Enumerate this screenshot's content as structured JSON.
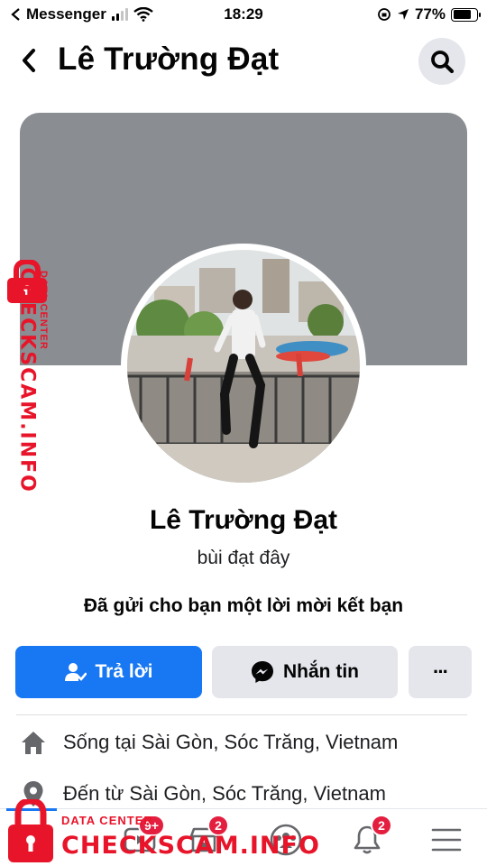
{
  "status_bar": {
    "carrier": "Messenger",
    "time": "18:29",
    "battery": "77%",
    "battery_level": 0.77
  },
  "header": {
    "title": "Lê Trường Đạt",
    "back_icon": "chevron-left-icon",
    "search_icon": "search-icon"
  },
  "profile": {
    "name": "Lê Trường Đạt",
    "bio": "bùi đạt đây",
    "request_text": "Đã gửi cho bạn một lời mời kết bạn",
    "cover_color": "#8a8d91"
  },
  "actions": {
    "reply_label": "Trả lời",
    "message_label": "Nhắn tin",
    "more_label": "···",
    "primary_color": "#1877f2"
  },
  "info": {
    "lives_in": "Sống tại Sài Gòn, Sóc Trăng, Vietnam",
    "from": "Đến từ Sài Gòn, Sóc Trăng, Vietnam"
  },
  "tabbar": {
    "tabs": [
      {
        "name": "home",
        "icon": "home-icon",
        "badge": ""
      },
      {
        "name": "watch",
        "icon": "video-icon",
        "badge": "9+"
      },
      {
        "name": "marketplace",
        "icon": "store-icon",
        "badge": "2"
      },
      {
        "name": "groups",
        "icon": "groups-icon",
        "badge": ""
      },
      {
        "name": "notifications",
        "icon": "bell-icon",
        "badge": "2"
      },
      {
        "name": "menu",
        "icon": "menu-icon",
        "badge": ""
      }
    ]
  },
  "watermark": {
    "side_text": "CHECKSCAM.INFO",
    "side_small": "DATA CENTER",
    "bottom_text": "CHECKSCAM.INFO",
    "bottom_small": "DATA CENTER",
    "color": "#e8142a"
  }
}
